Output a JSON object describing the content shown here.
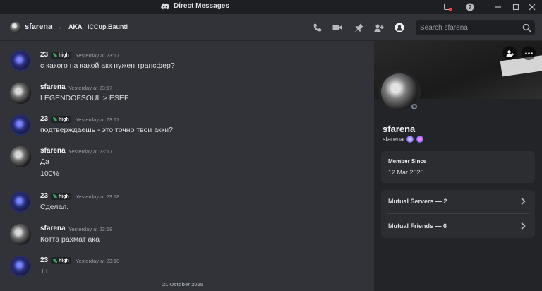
{
  "window": {
    "title": "Direct Messages"
  },
  "header": {
    "username": "sfarena",
    "aka_label": "AKA",
    "aka_name": "iCCup.Baunti",
    "search_placeholder": "Search sfarena"
  },
  "messages": [
    {
      "author": "23",
      "badge": "high",
      "time": "Yesterday at 23:17",
      "lines": [
        "с какого на какой акк нужен трансфер?"
      ],
      "avatar": "23"
    },
    {
      "author": "sfarena",
      "badge": "",
      "time": "Yesterday at 23:17",
      "lines": [
        "LEGENDOFSOUL > ESEF"
      ],
      "avatar": "sf"
    },
    {
      "author": "23",
      "badge": "high",
      "time": "Yesterday at 23:17",
      "lines": [
        "подтверждаешь - это точно твои акки?"
      ],
      "avatar": "23"
    },
    {
      "author": "sfarena",
      "badge": "",
      "time": "Yesterday at 23:17",
      "lines": [
        "Да",
        "100%"
      ],
      "avatar": "sf"
    },
    {
      "author": "23",
      "badge": "high",
      "time": "Yesterday at 23:18",
      "lines": [
        "Сделал."
      ],
      "avatar": "23"
    },
    {
      "author": "sfarena",
      "badge": "",
      "time": "Yesterday at 23:18",
      "lines": [
        "Котта рахмат ака"
      ],
      "avatar": "sf"
    },
    {
      "author": "23",
      "badge": "high",
      "time": "Yesterday at 23:18",
      "lines": [
        "++"
      ],
      "avatar": "23"
    }
  ],
  "date_divider": "21 October 2025",
  "profile": {
    "display_name": "sfarena",
    "username": "sfarena",
    "member_since_label": "Member Since",
    "member_since_value": "12 Mar 2020",
    "mutual_servers": "Mutual Servers — 2",
    "mutual_friends": "Mutual Friends — 6"
  },
  "colors": {
    "background": "#313338",
    "titlebar": "#1e1f22",
    "panel": "#232428",
    "card": "#2b2d31",
    "badge_green": "#3ba55d"
  }
}
